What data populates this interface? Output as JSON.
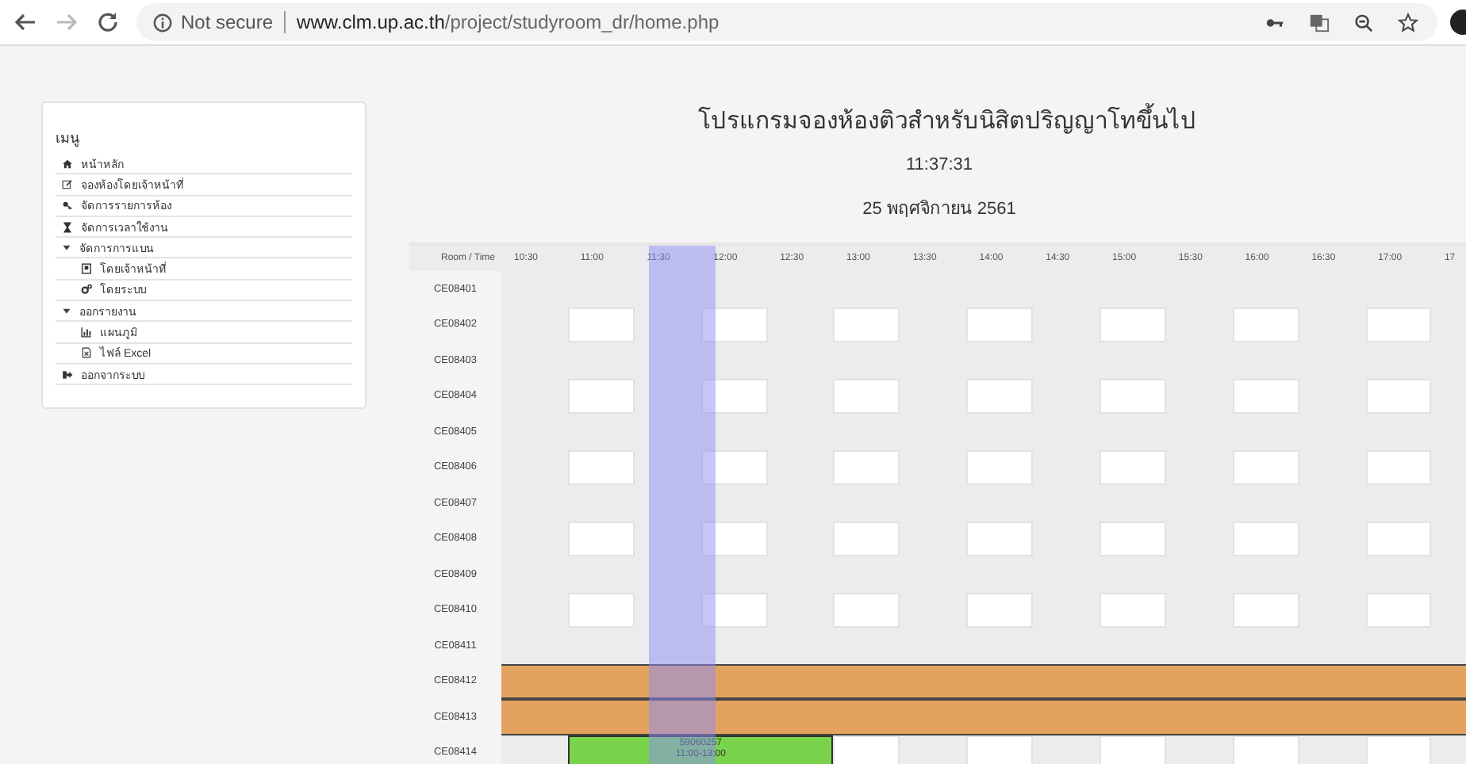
{
  "browser": {
    "security": "Not secure",
    "url_host": "www.clm.up.ac.th",
    "url_path": "/project/studyroom_dr/home.php"
  },
  "menu": {
    "title": "เมนู",
    "items": [
      {
        "label": "หน้าหลัก",
        "kind": "link"
      },
      {
        "label": "จองห้องโดยเจ้าหน้าที่",
        "kind": "link"
      },
      {
        "label": "จัดการรายการห้อง",
        "kind": "link"
      },
      {
        "label": "จัดการเวลาใช้งาน",
        "kind": "link"
      },
      {
        "label": "จัดการการแบน",
        "kind": "group",
        "expanded": true,
        "children": [
          {
            "label": "โดยเจ้าหน้าที่"
          },
          {
            "label": "โดยระบบ"
          }
        ]
      },
      {
        "label": "ออกรายงาน",
        "kind": "group",
        "expanded": true,
        "children": [
          {
            "label": "แผนภูมิ"
          },
          {
            "label": "ไฟล์ Excel"
          }
        ]
      },
      {
        "label": "ออกจากระบบ",
        "kind": "link"
      }
    ]
  },
  "title": "โปรแกรมจองห้องติวสำหรับนิสิตปริญญาโทขึ้นไป",
  "clock": "11:37:31",
  "date": "25  พฤศจิกายน  2561",
  "schedule": {
    "corner": "Room / Time",
    "times": [
      "10:30",
      "11:00",
      "11:30",
      "12:00",
      "12:30",
      "13:00",
      "13:30",
      "14:00",
      "14:30",
      "15:00",
      "15:30",
      "16:00",
      "16:30",
      "17:00",
      "17"
    ],
    "rooms": [
      {
        "room": "CE08401",
        "kind": "open"
      },
      {
        "room": "CE08402",
        "kind": "open"
      },
      {
        "room": "CE08403",
        "kind": "open"
      },
      {
        "room": "CE08404",
        "kind": "open"
      },
      {
        "room": "CE08405",
        "kind": "open"
      },
      {
        "room": "CE08406",
        "kind": "open"
      },
      {
        "room": "CE08407",
        "kind": "open"
      },
      {
        "room": "CE08408",
        "kind": "open"
      },
      {
        "room": "CE08409",
        "kind": "open"
      },
      {
        "room": "CE08410",
        "kind": "open"
      },
      {
        "room": "CE08411",
        "kind": "open"
      },
      {
        "room": "CE08412",
        "kind": "closed"
      },
      {
        "room": "CE08413",
        "kind": "closed"
      },
      {
        "room": "CE08414",
        "kind": "open",
        "booking": {
          "id": "59060257",
          "time": "11:00-13:00"
        }
      }
    ]
  }
}
